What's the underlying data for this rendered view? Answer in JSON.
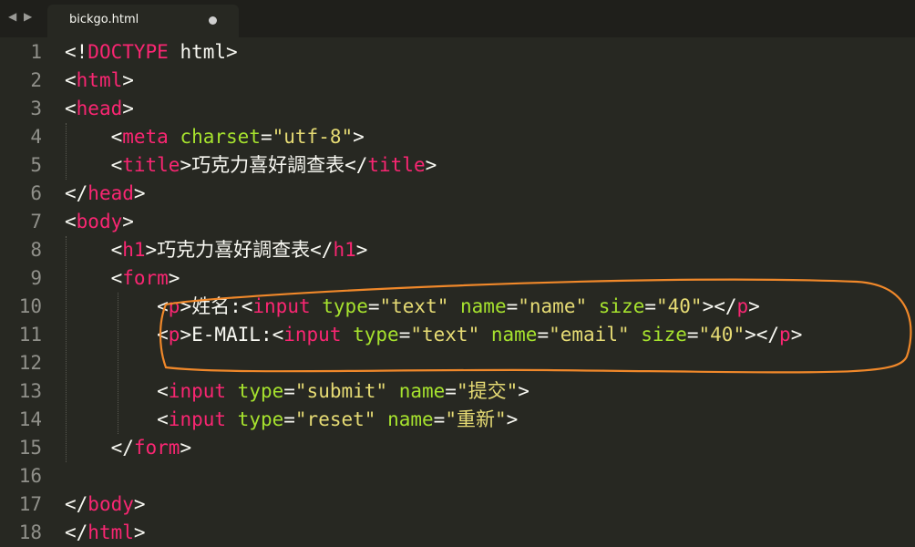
{
  "tab": {
    "filename": "bickgo.html",
    "nav_arrows": "◀ ▶"
  },
  "colors": {
    "background": "#272822",
    "tag": "#f92672",
    "attribute": "#a6e22e",
    "string": "#e6db74",
    "text": "#f8f8f2",
    "gutter": "#90908a",
    "highlight_oval": "#f0882a"
  },
  "line_numbers": [
    "1",
    "2",
    "3",
    "4",
    "5",
    "6",
    "7",
    "8",
    "9",
    "10",
    "11",
    "12",
    "13",
    "14",
    "15",
    "16",
    "17",
    "18"
  ],
  "lines": [
    [
      {
        "c": "p",
        "t": "<!"
      },
      {
        "c": "t",
        "t": "DOCTYPE"
      },
      {
        "c": "p",
        "t": " html>"
      }
    ],
    [
      {
        "c": "p",
        "t": "<"
      },
      {
        "c": "t",
        "t": "html"
      },
      {
        "c": "p",
        "t": ">"
      }
    ],
    [
      {
        "c": "p",
        "t": "<"
      },
      {
        "c": "t",
        "t": "head"
      },
      {
        "c": "p",
        "t": ">"
      }
    ],
    [
      {
        "c": "p",
        "t": "    <"
      },
      {
        "c": "t",
        "t": "meta"
      },
      {
        "c": "p",
        "t": " "
      },
      {
        "c": "a",
        "t": "charset"
      },
      {
        "c": "p",
        "t": "="
      },
      {
        "c": "s",
        "t": "\"utf-8\""
      },
      {
        "c": "p",
        "t": ">"
      }
    ],
    [
      {
        "c": "p",
        "t": "    <"
      },
      {
        "c": "t",
        "t": "title"
      },
      {
        "c": "p",
        "t": ">巧克力喜好調查表</"
      },
      {
        "c": "t",
        "t": "title"
      },
      {
        "c": "p",
        "t": ">"
      }
    ],
    [
      {
        "c": "p",
        "t": "</"
      },
      {
        "c": "t",
        "t": "head"
      },
      {
        "c": "p",
        "t": ">"
      }
    ],
    [
      {
        "c": "p",
        "t": "<"
      },
      {
        "c": "t",
        "t": "body"
      },
      {
        "c": "p",
        "t": ">"
      }
    ],
    [
      {
        "c": "p",
        "t": "    <"
      },
      {
        "c": "t",
        "t": "h1"
      },
      {
        "c": "p",
        "t": ">巧克力喜好調查表</"
      },
      {
        "c": "t",
        "t": "h1"
      },
      {
        "c": "p",
        "t": ">"
      }
    ],
    [
      {
        "c": "p",
        "t": "    <"
      },
      {
        "c": "t",
        "t": "form"
      },
      {
        "c": "p",
        "t": ">"
      }
    ],
    [
      {
        "c": "p",
        "t": "        <"
      },
      {
        "c": "t",
        "t": "p"
      },
      {
        "c": "p",
        "t": ">姓名:<"
      },
      {
        "c": "t",
        "t": "input"
      },
      {
        "c": "p",
        "t": " "
      },
      {
        "c": "a",
        "t": "type"
      },
      {
        "c": "p",
        "t": "="
      },
      {
        "c": "s",
        "t": "\"text\""
      },
      {
        "c": "p",
        "t": " "
      },
      {
        "c": "a",
        "t": "name"
      },
      {
        "c": "p",
        "t": "="
      },
      {
        "c": "s",
        "t": "\"name\""
      },
      {
        "c": "p",
        "t": " "
      },
      {
        "c": "a",
        "t": "size"
      },
      {
        "c": "p",
        "t": "="
      },
      {
        "c": "s",
        "t": "\"40\""
      },
      {
        "c": "p",
        "t": "></"
      },
      {
        "c": "t",
        "t": "p"
      },
      {
        "c": "p",
        "t": ">"
      }
    ],
    [
      {
        "c": "p",
        "t": "        <"
      },
      {
        "c": "t",
        "t": "p"
      },
      {
        "c": "p",
        "t": ">E-MAIL:<"
      },
      {
        "c": "t",
        "t": "input"
      },
      {
        "c": "p",
        "t": " "
      },
      {
        "c": "a",
        "t": "type"
      },
      {
        "c": "p",
        "t": "="
      },
      {
        "c": "s",
        "t": "\"text\""
      },
      {
        "c": "p",
        "t": " "
      },
      {
        "c": "a",
        "t": "name"
      },
      {
        "c": "p",
        "t": "="
      },
      {
        "c": "s",
        "t": "\"email\""
      },
      {
        "c": "p",
        "t": " "
      },
      {
        "c": "a",
        "t": "size"
      },
      {
        "c": "p",
        "t": "="
      },
      {
        "c": "s",
        "t": "\"40\""
      },
      {
        "c": "p",
        "t": "></"
      },
      {
        "c": "t",
        "t": "p"
      },
      {
        "c": "p",
        "t": ">"
      }
    ],
    [],
    [
      {
        "c": "p",
        "t": "        <"
      },
      {
        "c": "t",
        "t": "input"
      },
      {
        "c": "p",
        "t": " "
      },
      {
        "c": "a",
        "t": "type"
      },
      {
        "c": "p",
        "t": "="
      },
      {
        "c": "s",
        "t": "\"submit\""
      },
      {
        "c": "p",
        "t": " "
      },
      {
        "c": "a",
        "t": "name"
      },
      {
        "c": "p",
        "t": "="
      },
      {
        "c": "s",
        "t": "\"提交\""
      },
      {
        "c": "p",
        "t": ">"
      }
    ],
    [
      {
        "c": "p",
        "t": "        <"
      },
      {
        "c": "t",
        "t": "input"
      },
      {
        "c": "p",
        "t": " "
      },
      {
        "c": "a",
        "t": "type"
      },
      {
        "c": "p",
        "t": "="
      },
      {
        "c": "s",
        "t": "\"reset\""
      },
      {
        "c": "p",
        "t": " "
      },
      {
        "c": "a",
        "t": "name"
      },
      {
        "c": "p",
        "t": "="
      },
      {
        "c": "s",
        "t": "\"重新\""
      },
      {
        "c": "p",
        "t": ">"
      }
    ],
    [
      {
        "c": "p",
        "t": "    </"
      },
      {
        "c": "t",
        "t": "form"
      },
      {
        "c": "p",
        "t": ">"
      }
    ],
    [],
    [
      {
        "c": "p",
        "t": "</"
      },
      {
        "c": "t",
        "t": "body"
      },
      {
        "c": "p",
        "t": ">"
      }
    ],
    [
      {
        "c": "p",
        "t": "</"
      },
      {
        "c": "t",
        "t": "html"
      },
      {
        "c": "p",
        "t": ">"
      }
    ]
  ]
}
